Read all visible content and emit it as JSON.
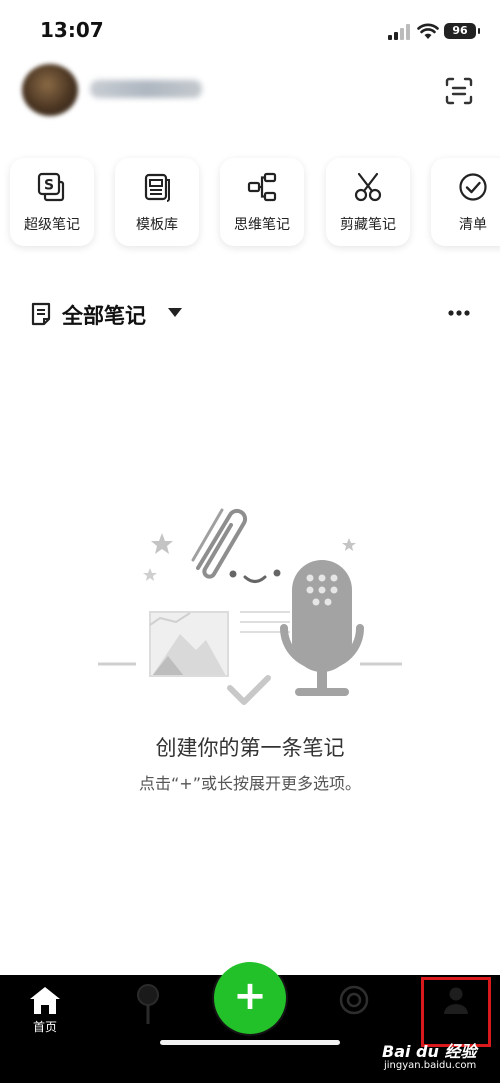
{
  "status_bar": {
    "time": "13:07",
    "battery": "96"
  },
  "tools": [
    {
      "label": "超级笔记",
      "icon": "super-note-icon"
    },
    {
      "label": "模板库",
      "icon": "template-icon"
    },
    {
      "label": "思维笔记",
      "icon": "mindmap-icon"
    },
    {
      "label": "剪藏笔记",
      "icon": "scissors-icon"
    },
    {
      "label": "清单",
      "icon": "checklist-icon"
    }
  ],
  "section": {
    "title": "全部笔记"
  },
  "empty_state": {
    "title": "创建你的第一条笔记",
    "subtitle": "点击“+”或长按展开更多选项。"
  },
  "bottom_nav": {
    "home_label": "首页",
    "fab_label": "+",
    "active_color": "#22c12a"
  },
  "watermark": {
    "brand": "Bai du 经验",
    "site": "jingyan.baidu.com"
  }
}
